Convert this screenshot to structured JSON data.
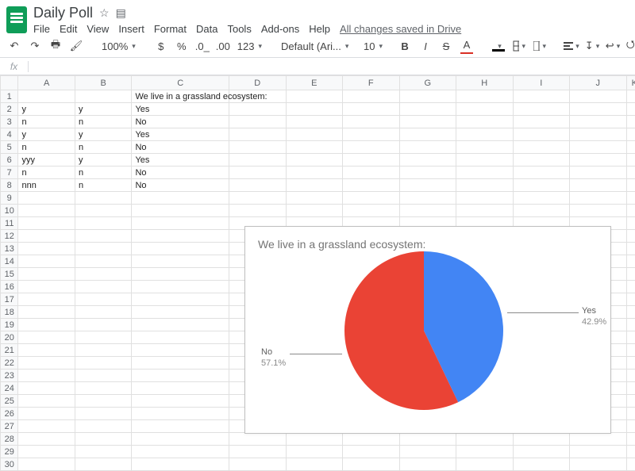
{
  "doc": {
    "title": "Daily Poll"
  },
  "menu": {
    "items": [
      "File",
      "Edit",
      "View",
      "Insert",
      "Format",
      "Data",
      "Tools",
      "Add-ons",
      "Help"
    ],
    "status": "All changes saved in Drive"
  },
  "toolbar": {
    "zoom": "100%",
    "currency": "$",
    "percent": "%",
    "dec_dec": ".0",
    "inc_dec": ".00",
    "number_format": "123",
    "font": "Default (Ari...",
    "font_size": "10",
    "bold": "B",
    "italic": "I",
    "strike": "S",
    "textcolor": "A"
  },
  "fx": {
    "label": "fx",
    "value": ""
  },
  "columns": [
    "A",
    "B",
    "C",
    "D",
    "E",
    "F",
    "G",
    "H",
    "I",
    "J",
    "K"
  ],
  "rows": [
    {
      "n": 1,
      "A": "",
      "B": "",
      "C": "We live in a grassland ecosystem:"
    },
    {
      "n": 2,
      "A": "y",
      "B": "y",
      "C": "Yes"
    },
    {
      "n": 3,
      "A": "n",
      "B": "n",
      "C": "No"
    },
    {
      "n": 4,
      "A": "y",
      "B": "y",
      "C": "Yes"
    },
    {
      "n": 5,
      "A": "n",
      "B": "n",
      "C": "No"
    },
    {
      "n": 6,
      "A": "yyy",
      "B": "y",
      "C": "Yes"
    },
    {
      "n": 7,
      "A": "n",
      "B": "n",
      "C": "No"
    },
    {
      "n": 8,
      "A": "nnn",
      "B": "n",
      "C": "No"
    },
    {
      "n": 9
    },
    {
      "n": 10
    },
    {
      "n": 11
    },
    {
      "n": 12
    },
    {
      "n": 13
    },
    {
      "n": 14
    },
    {
      "n": 15
    },
    {
      "n": 16
    },
    {
      "n": 17
    },
    {
      "n": 18
    },
    {
      "n": 19
    },
    {
      "n": 20
    },
    {
      "n": 21
    },
    {
      "n": 22
    },
    {
      "n": 23
    },
    {
      "n": 24
    },
    {
      "n": 25
    },
    {
      "n": 26
    },
    {
      "n": 27
    },
    {
      "n": 28
    },
    {
      "n": 29
    },
    {
      "n": 30
    }
  ],
  "chart_data": {
    "type": "pie",
    "title": "We live in a grassland ecosystem:",
    "categories": [
      "Yes",
      "No"
    ],
    "values": [
      42.9,
      57.1
    ],
    "colors": [
      "#4285f4",
      "#ea4335"
    ],
    "labels": {
      "yes": {
        "name": "Yes",
        "pct": "42.9%"
      },
      "no": {
        "name": "No",
        "pct": "57.1%"
      }
    }
  }
}
